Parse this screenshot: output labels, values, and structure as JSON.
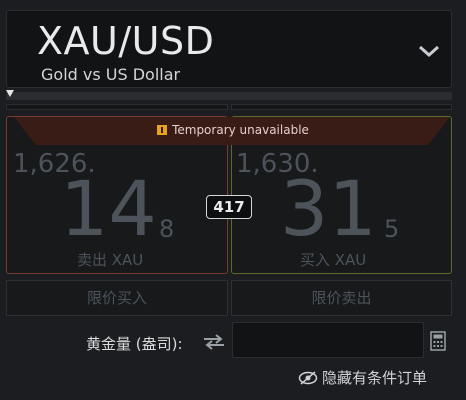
{
  "header": {
    "symbol": "XAU/USD",
    "subtitle": "Gold vs US Dollar",
    "icons": {
      "dropdown": "chevron-down-icon"
    }
  },
  "status": {
    "text": "Temporary unavailable",
    "icon": "pause-icon",
    "color": "#e8a21c"
  },
  "sell": {
    "price_prefix": "1,626.",
    "price_big": "14",
    "price_sup": "8",
    "label": "卖出 XAU"
  },
  "buy": {
    "price_prefix": "1,630.",
    "price_big": "31",
    "price_sup": "5",
    "label": "买入 XAU"
  },
  "spread": "417",
  "limit_buttons": {
    "buy_limit": "限价买入",
    "sell_limit": "限价卖出"
  },
  "amount": {
    "label": "黄金量 (盎司):",
    "value": "",
    "icons": {
      "swap": "swap-icon",
      "calculator": "calculator-icon"
    }
  },
  "hide_orders": {
    "label": "隐藏有条件订单",
    "icon": "eye-slash-icon"
  },
  "colors": {
    "background": "#1b1d20",
    "sell_border": "#7a3a31",
    "buy_border": "#5d6a2a",
    "banner": "#3a1c17",
    "disabled_text": "#4c535b"
  }
}
